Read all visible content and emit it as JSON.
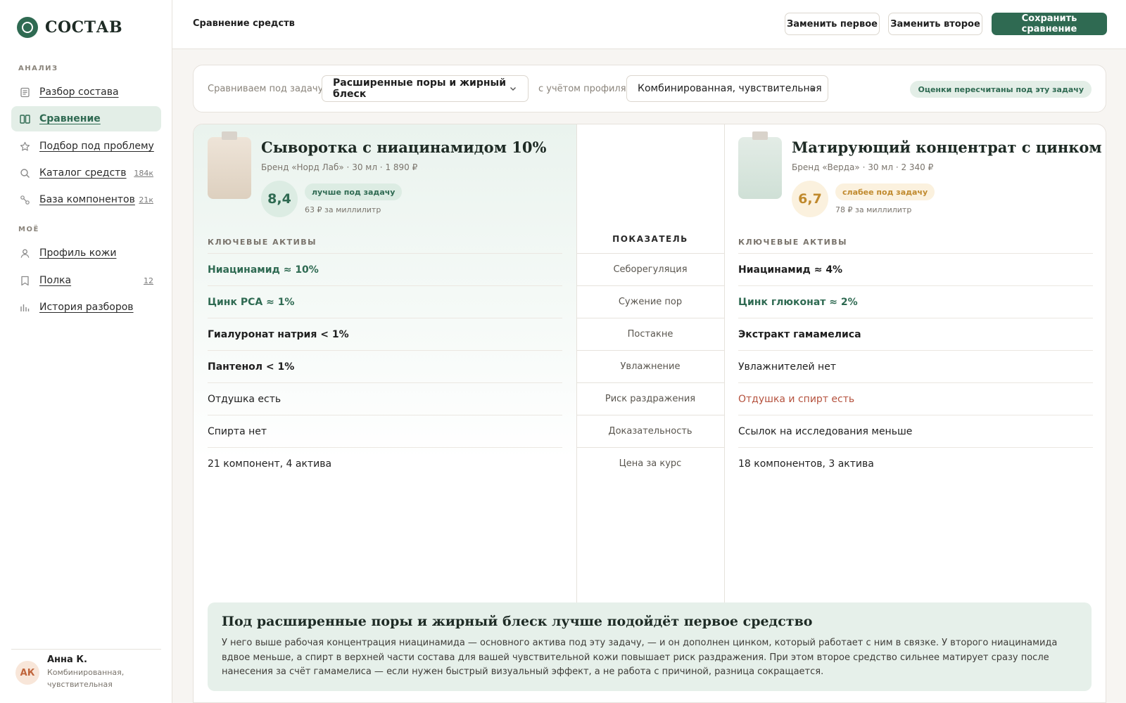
{
  "brand": {
    "name": "СОСТАВ"
  },
  "sidebar": {
    "sections": [
      {
        "title": "АНАЛИЗ"
      },
      {
        "title": "МОЁ"
      }
    ],
    "items": [
      {
        "label": "Разбор состава",
        "icon": "document-icon",
        "count": ""
      },
      {
        "label": "Сравнение",
        "icon": "compare-icon",
        "count": "",
        "active": true
      },
      {
        "label": "Подбор под проблему",
        "icon": "star-icon",
        "count": ""
      },
      {
        "label": "Каталог средств",
        "icon": "search-icon",
        "count": "184к"
      },
      {
        "label": "База компонентов",
        "icon": "molecule-icon",
        "count": "21к"
      },
      {
        "label": "Профиль кожи",
        "icon": "user-icon",
        "count": ""
      },
      {
        "label": "Полка",
        "icon": "bookmark-icon",
        "count": "12"
      },
      {
        "label": "История разборов",
        "icon": "bar-chart-icon",
        "count": ""
      }
    ],
    "user": {
      "initials": "АК",
      "name": "Анна К.",
      "skin": "Комбинированная, чувствительная"
    }
  },
  "header": {
    "title": "Сравнение средств",
    "replace_first": "Заменить первое",
    "replace_second": "Заменить второе",
    "save": "Сохранить сравнение"
  },
  "task": {
    "label": "Сравниваем под задачу",
    "task_value": "Расширенные поры и жирный блеск",
    "profile_label": "с учётом профиля",
    "profile_value": "Комбинированная, чувствительная",
    "badge": "Оценки пересчитаны под эту задачу"
  },
  "colors": {
    "accent": "#2f6a52",
    "good": "#2f6a52",
    "warn": "#c08a2e",
    "bad": "#b5523e"
  },
  "products": [
    {
      "name": "Сыворотка с ниацинамидом 10%",
      "meta": "Бренд «Норд Лаб» · 30 мл · 1 890 ₽",
      "score": "8,4",
      "verdict": "лучше под задачу",
      "price_per_ml": "63 ₽ за миллилитр",
      "actives_title": "КЛЮЧЕВЫЕ АКТИВЫ",
      "rows": [
        {
          "text": "Ниацинамид ≈ 10%",
          "tone": "green"
        },
        {
          "text": "Цинк PCA ≈ 1%",
          "tone": "green"
        },
        {
          "text": "Гиалуронат натрия < 1%",
          "tone": "bold"
        },
        {
          "text": "Пантенол < 1%",
          "tone": "bold"
        },
        {
          "text": "Отдушка есть",
          "tone": "plain"
        },
        {
          "text": "Спирта нет",
          "tone": "plain"
        },
        {
          "text": "21 компонент, 4 актива",
          "tone": "plain"
        }
      ]
    },
    {
      "name": "Матирующий концентрат с цинком",
      "meta": "Бренд «Верда» · 30 мл · 2 340 ₽",
      "score": "6,7",
      "verdict": "слабее под задачу",
      "price_per_ml": "78 ₽ за миллилитр",
      "actives_title": "КЛЮЧЕВЫЕ АКТИВЫ",
      "rows": [
        {
          "text": "Ниацинамид ≈ 4%",
          "tone": "bold"
        },
        {
          "text": "Цинк глюконат ≈ 2%",
          "tone": "green"
        },
        {
          "text": "Экстракт гамамелиса",
          "tone": "bold"
        },
        {
          "text": "Увлажнителей нет",
          "tone": "plain"
        },
        {
          "text": "Отдушка и спирт есть",
          "tone": "red"
        },
        {
          "text": "Ссылок на исследования меньше",
          "tone": "plain"
        },
        {
          "text": "18 компонентов, 3 актива",
          "tone": "plain"
        }
      ]
    }
  ],
  "metrics": {
    "title": "ПОКАЗАТЕЛЬ",
    "items": [
      "Себорегуляция",
      "Сужение пор",
      "Постакне",
      "Увлажнение",
      "Риск раздражения",
      "Доказательность",
      "Цена за курс"
    ]
  },
  "summary": {
    "title": "Под расширенные поры и жирный блеск лучше подойдёт первое средство",
    "text": "У него выше рабочая концентрация ниацинамида — основного актива под эту задачу, — и он дополнен цинком, который работает с ним в связке. У второго ниацинамида вдвое меньше, а спирт в верхней части состава для вашей чувствительной кожи повышает риск раздражения. При этом второе средство сильнее матирует сразу после нанесения за счёт гамамелиса — если нужен быстрый визуальный эффект, а не работа с причиной, разница сокращается."
  }
}
